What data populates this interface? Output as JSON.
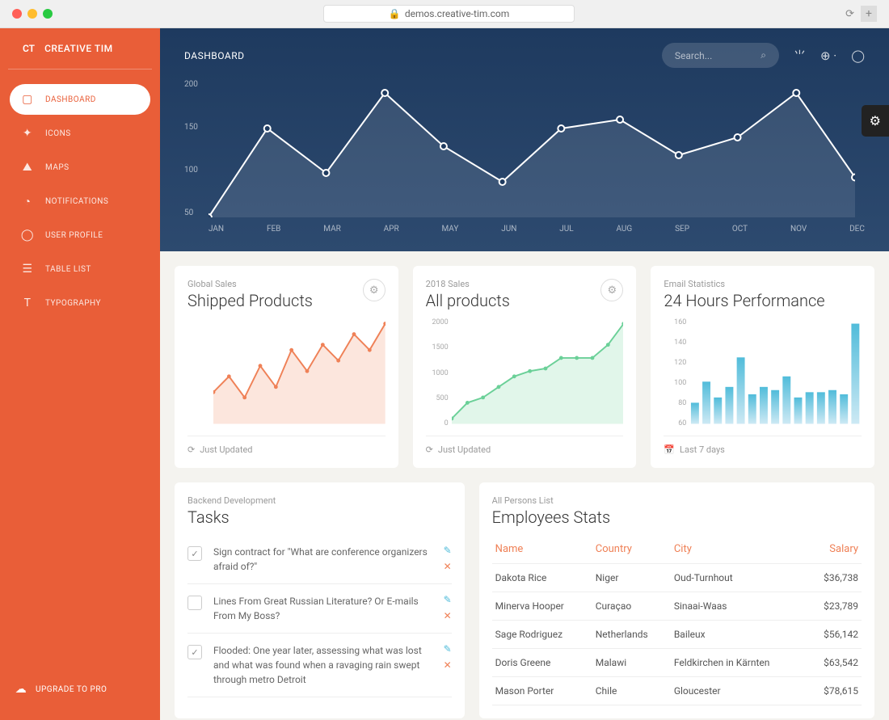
{
  "browser": {
    "url": "demos.creative-tim.com"
  },
  "brand": {
    "logo": "CT",
    "label": "CREATIVE TIM"
  },
  "sidebar": {
    "items": [
      {
        "label": "DASHBOARD",
        "icon": "▢"
      },
      {
        "label": "ICONS",
        "icon": "✦"
      },
      {
        "label": "MAPS",
        "icon": "⛰"
      },
      {
        "label": "NOTIFICATIONS",
        "icon": "◔"
      },
      {
        "label": "USER PROFILE",
        "icon": "◯"
      },
      {
        "label": "TABLE LIST",
        "icon": "☰"
      },
      {
        "label": "TYPOGRAPHY",
        "icon": "T"
      }
    ],
    "upgrade": "UPGRADE TO PRO"
  },
  "topbar": {
    "title": "DASHBOARD",
    "search_placeholder": "Search..."
  },
  "chart_data": [
    {
      "type": "line",
      "title": "Dashboard Main Chart",
      "categories": [
        "JAN",
        "FEB",
        "MAR",
        "APR",
        "MAY",
        "JUN",
        "JUL",
        "AUG",
        "SEP",
        "OCT",
        "NOV",
        "DEC"
      ],
      "values": [
        50,
        150,
        100,
        190,
        130,
        90,
        150,
        160,
        120,
        140,
        190,
        95
      ],
      "ylim": [
        50,
        200
      ],
      "yticks": [
        50,
        100,
        150,
        200
      ]
    },
    {
      "type": "area",
      "title": "Shipped Products",
      "x": [
        1,
        2,
        3,
        4,
        5,
        6,
        7,
        8,
        9,
        10,
        11,
        12
      ],
      "values": [
        30,
        45,
        25,
        55,
        35,
        70,
        50,
        75,
        60,
        85,
        70,
        95
      ],
      "color": "#ef8157"
    },
    {
      "type": "area",
      "title": "All products",
      "x": [
        1,
        2,
        3,
        4,
        5,
        6,
        7,
        8,
        9,
        10,
        11,
        12
      ],
      "values": [
        100,
        400,
        500,
        700,
        900,
        1000,
        1050,
        1250,
        1250,
        1250,
        1500,
        1900
      ],
      "ylim": [
        0,
        2000
      ],
      "yticks": [
        0,
        500,
        1000,
        1500,
        2000
      ],
      "color": "#6bd098"
    },
    {
      "type": "bar",
      "title": "24 Hours Performance",
      "x": [
        1,
        2,
        3,
        4,
        5,
        6,
        7,
        8,
        9,
        10,
        11,
        12,
        13,
        14,
        15
      ],
      "values": [
        80,
        100,
        85,
        95,
        123,
        88,
        95,
        92,
        105,
        85,
        90,
        90,
        92,
        88,
        155
      ],
      "ylim": [
        60,
        160
      ],
      "yticks": [
        60,
        80,
        100,
        120,
        140,
        160
      ],
      "color": "#51bcda"
    }
  ],
  "cards": {
    "shipped": {
      "overline": "Global Sales",
      "title": "Shipped Products",
      "footer": "Just Updated"
    },
    "products": {
      "overline": "2018 Sales",
      "title": "All products",
      "footer": "Just Updated"
    },
    "perf": {
      "overline": "Email Statistics",
      "title": "24 Hours Performance",
      "footer": "Last 7 days"
    },
    "tasks": {
      "overline": "Backend Development",
      "title": "Tasks",
      "items": [
        {
          "text": "Sign contract for \"What are conference organizers afraid of?\"",
          "checked": true
        },
        {
          "text": "Lines From Great Russian Literature? Or E-mails From My Boss?",
          "checked": false
        },
        {
          "text": "Flooded: One year later, assessing what was lost and what was found when a ravaging rain swept through metro Detroit",
          "checked": true
        }
      ]
    },
    "employees": {
      "overline": "All Persons List",
      "title": "Employees Stats",
      "columns": [
        "Name",
        "Country",
        "City",
        "Salary"
      ],
      "rows": [
        {
          "name": "Dakota Rice",
          "country": "Niger",
          "city": "Oud-Turnhout",
          "salary": "$36,738"
        },
        {
          "name": "Minerva Hooper",
          "country": "Curaçao",
          "city": "Sinaai-Waas",
          "salary": "$23,789"
        },
        {
          "name": "Sage Rodriguez",
          "country": "Netherlands",
          "city": "Baileux",
          "salary": "$56,142"
        },
        {
          "name": "Doris Greene",
          "country": "Malawi",
          "city": "Feldkirchen in Kärnten",
          "salary": "$63,542"
        },
        {
          "name": "Mason Porter",
          "country": "Chile",
          "city": "Gloucester",
          "salary": "$78,615"
        }
      ]
    }
  }
}
